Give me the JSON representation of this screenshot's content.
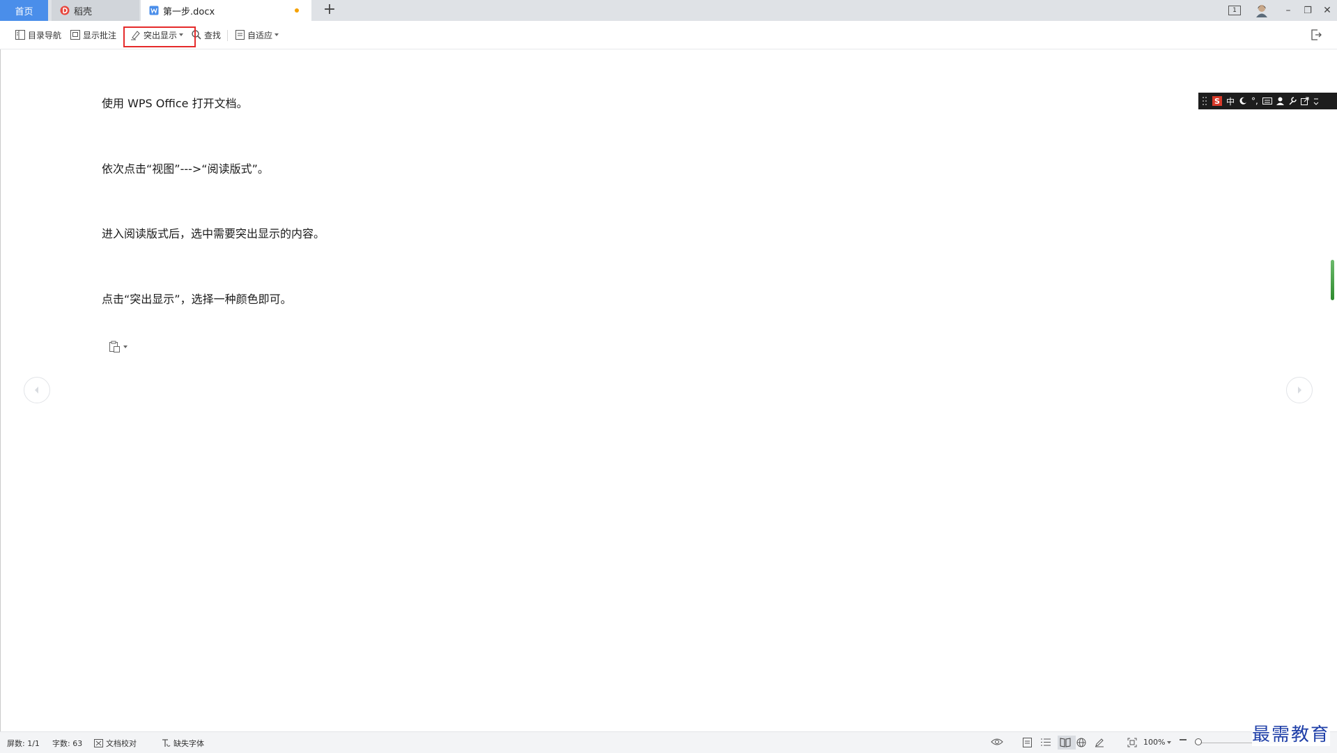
{
  "tabs": {
    "home": "首页",
    "daoke": "稻壳",
    "document": "第一步.docx",
    "new_tab": "+"
  },
  "window_controls": {
    "page_badge": "1",
    "minimize": "–",
    "restore": "❐",
    "close": "✕"
  },
  "toolbar": {
    "toc_nav": "目录导航",
    "show_comments": "显示批注",
    "highlight": "突出显示",
    "find": "查找",
    "fit": "自适应"
  },
  "document": {
    "paragraphs": [
      "使用 WPS Office 打开文档。",
      "依次点击“视图”--->“阅读版式”。",
      "进入阅读版式后，选中需要突出显示的内容。",
      "点击“突出显示”，选择一种颜色即可。"
    ]
  },
  "ime": {
    "lang": "中",
    "punct": "°,"
  },
  "statusbar": {
    "screen": "屏数: 1/1",
    "word_count": "字数: 63",
    "proofread": "文档校对",
    "missing_fonts": "缺失字体",
    "zoom": "100%"
  },
  "watermark": "最需教育",
  "colors": {
    "accent_blue": "#4a8eea",
    "highlight_frame": "#e52a2a",
    "unsaved_dot": "#f5a100"
  }
}
